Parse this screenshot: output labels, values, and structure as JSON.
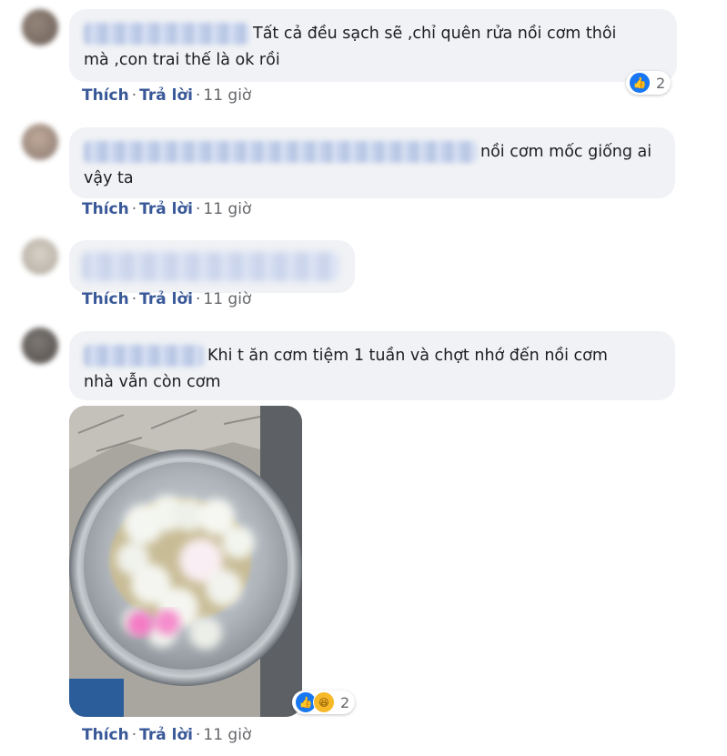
{
  "comments": [
    {
      "text": "Tất cả đều sạch sẽ ,chỉ quên rửa nồi cơm thôi mà ,con trai thế là ok rồi",
      "line1": "Tất cả đều sạch sẽ ,chỉ quên rửa nồi cơm thôi",
      "line2": "mà ,con trai thế là ok rồi",
      "like_label": "Thích",
      "reply_label": "Trả lời",
      "time": "11 giờ",
      "reactions": {
        "icons": [
          "like-icon"
        ],
        "count": "2"
      }
    },
    {
      "text": "nồi cơm mốc giống ai vậy ta",
      "line1": "nồi cơm mốc giống ai",
      "line2": "vậy ta",
      "like_label": "Thích",
      "reply_label": "Trả lời",
      "time": "11 giờ"
    },
    {
      "text": "",
      "like_label": "Thích",
      "reply_label": "Trả lời",
      "time": "11 giờ"
    },
    {
      "text": "Khi t ăn cơm tiệm 1 tuần và chợt nhớ đến nồi cơm nhà vẫn còn cơm",
      "line1": "Khi t ăn cơm tiệm 1 tuần và chợt nhớ đến nồi cơm",
      "line2": "nhà vẫn còn cơm",
      "like_label": "Thích",
      "reply_label": "Trả lời",
      "time": "11 giờ",
      "has_photo": true,
      "reactions": {
        "icons": [
          "like-icon",
          "haha-icon"
        ],
        "count": "2"
      }
    }
  ],
  "colors": {
    "bubble": "#f0f2f5",
    "action_link": "#385898",
    "meta_text": "#65676b",
    "like_blue": "#1877f2"
  }
}
